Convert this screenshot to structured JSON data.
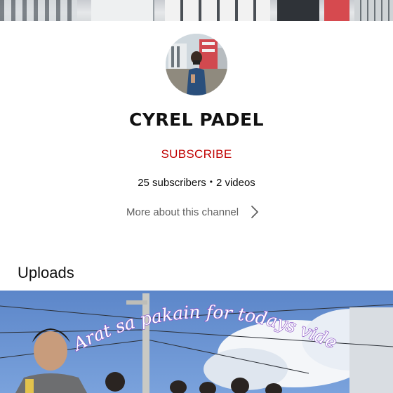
{
  "channel": {
    "name": "CYREL PADEL",
    "subscribe_label": "SUBSCRIBE",
    "subscribers": "25 subscribers",
    "separator": "•",
    "videos": "2 videos",
    "more_about": "More about this channel"
  },
  "sections": {
    "uploads_title": "Uploads"
  },
  "video": {
    "thumbnail_caption": "Arat sa pakain for todays video<<"
  },
  "colors": {
    "subscribe": "#c00000",
    "secondary_text": "#606060"
  },
  "icons": {
    "more_about": "chevron-right-icon"
  }
}
